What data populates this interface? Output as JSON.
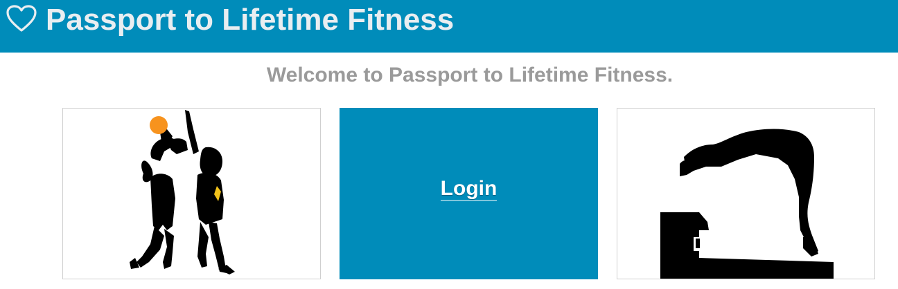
{
  "header": {
    "title": "Passport to Lifetime Fitness",
    "icon": "heart-outline-icon",
    "background_color": "#008cba"
  },
  "main": {
    "welcome_text": "Welcome to Passport to Lifetime Fitness.",
    "tiles": [
      {
        "image": "basketball-players-silhouette"
      },
      {
        "label": "Login",
        "background_color": "#008cba"
      },
      {
        "image": "swimmer-diving-silhouette"
      }
    ]
  }
}
